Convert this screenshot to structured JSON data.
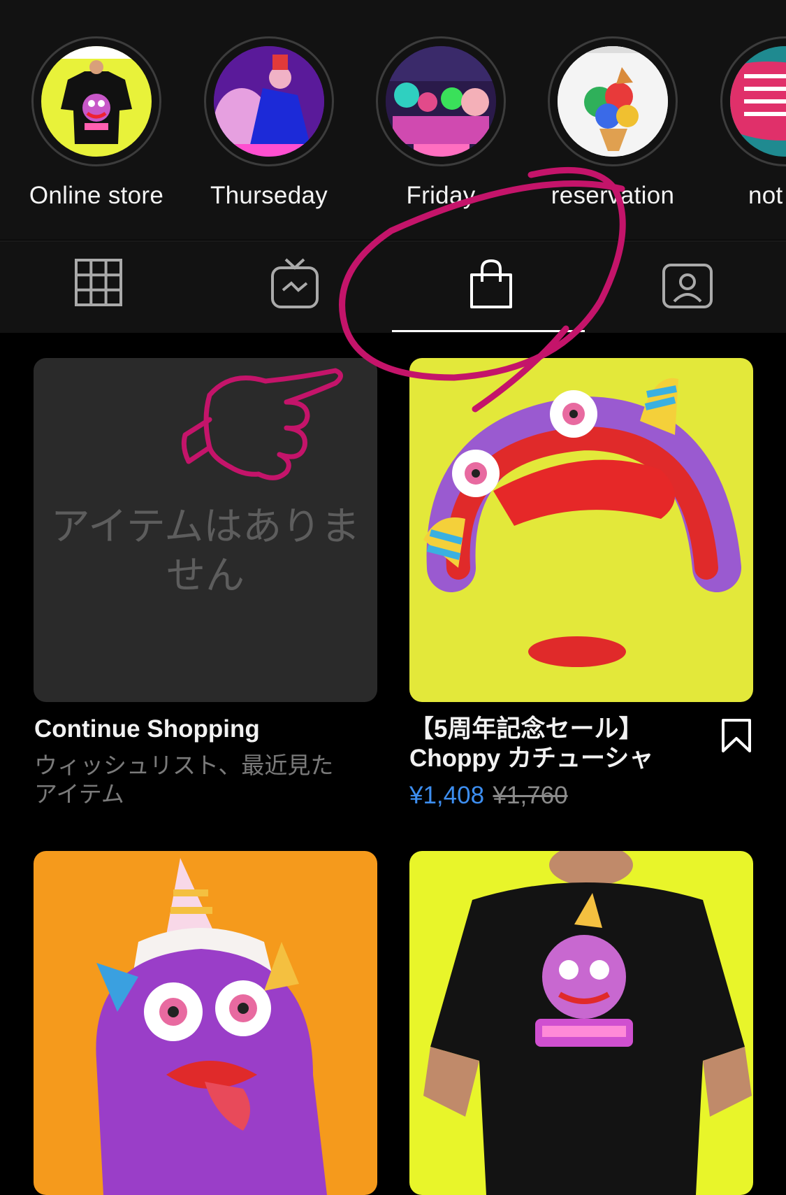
{
  "highlights": [
    {
      "label": "Online store",
      "cover_color": "#e8f23a"
    },
    {
      "label": "Thurseday",
      "cover_color": "#6b1fa8"
    },
    {
      "label": "Friday",
      "cover_color": "#2a1a4a"
    },
    {
      "label": "reservation",
      "cover_color": "#f2f2f2"
    },
    {
      "label": "not",
      "cover_color": "#1a9a8a"
    }
  ],
  "tabs": [
    {
      "name": "grid",
      "icon": "grid-icon"
    },
    {
      "name": "igtv",
      "icon": "tv-icon"
    },
    {
      "name": "shop",
      "icon": "shopping-bag-icon",
      "active": true
    },
    {
      "name": "tagged",
      "icon": "tagged-person-icon"
    }
  ],
  "empty_card": {
    "text_line1": "アイテムはありま",
    "text_line2": "せん",
    "title": "Continue Shopping",
    "subtitle_line1": "ウィッシュリスト、最近見た",
    "subtitle_line2": "アイテム"
  },
  "product": {
    "name_line1": "【5周年記念セール】",
    "name_line2": "Choppy カチューシャ",
    "price": "¥1,408",
    "original_price": "¥1,760",
    "bookmark_icon": "bookmark-icon"
  },
  "colors": {
    "accent_price": "#3d8ef0",
    "product1_bg": "#e3e83a",
    "product2_bg": "#f59a1c",
    "product3_bg": "#e8f52a",
    "annotation": "#c4146a"
  }
}
